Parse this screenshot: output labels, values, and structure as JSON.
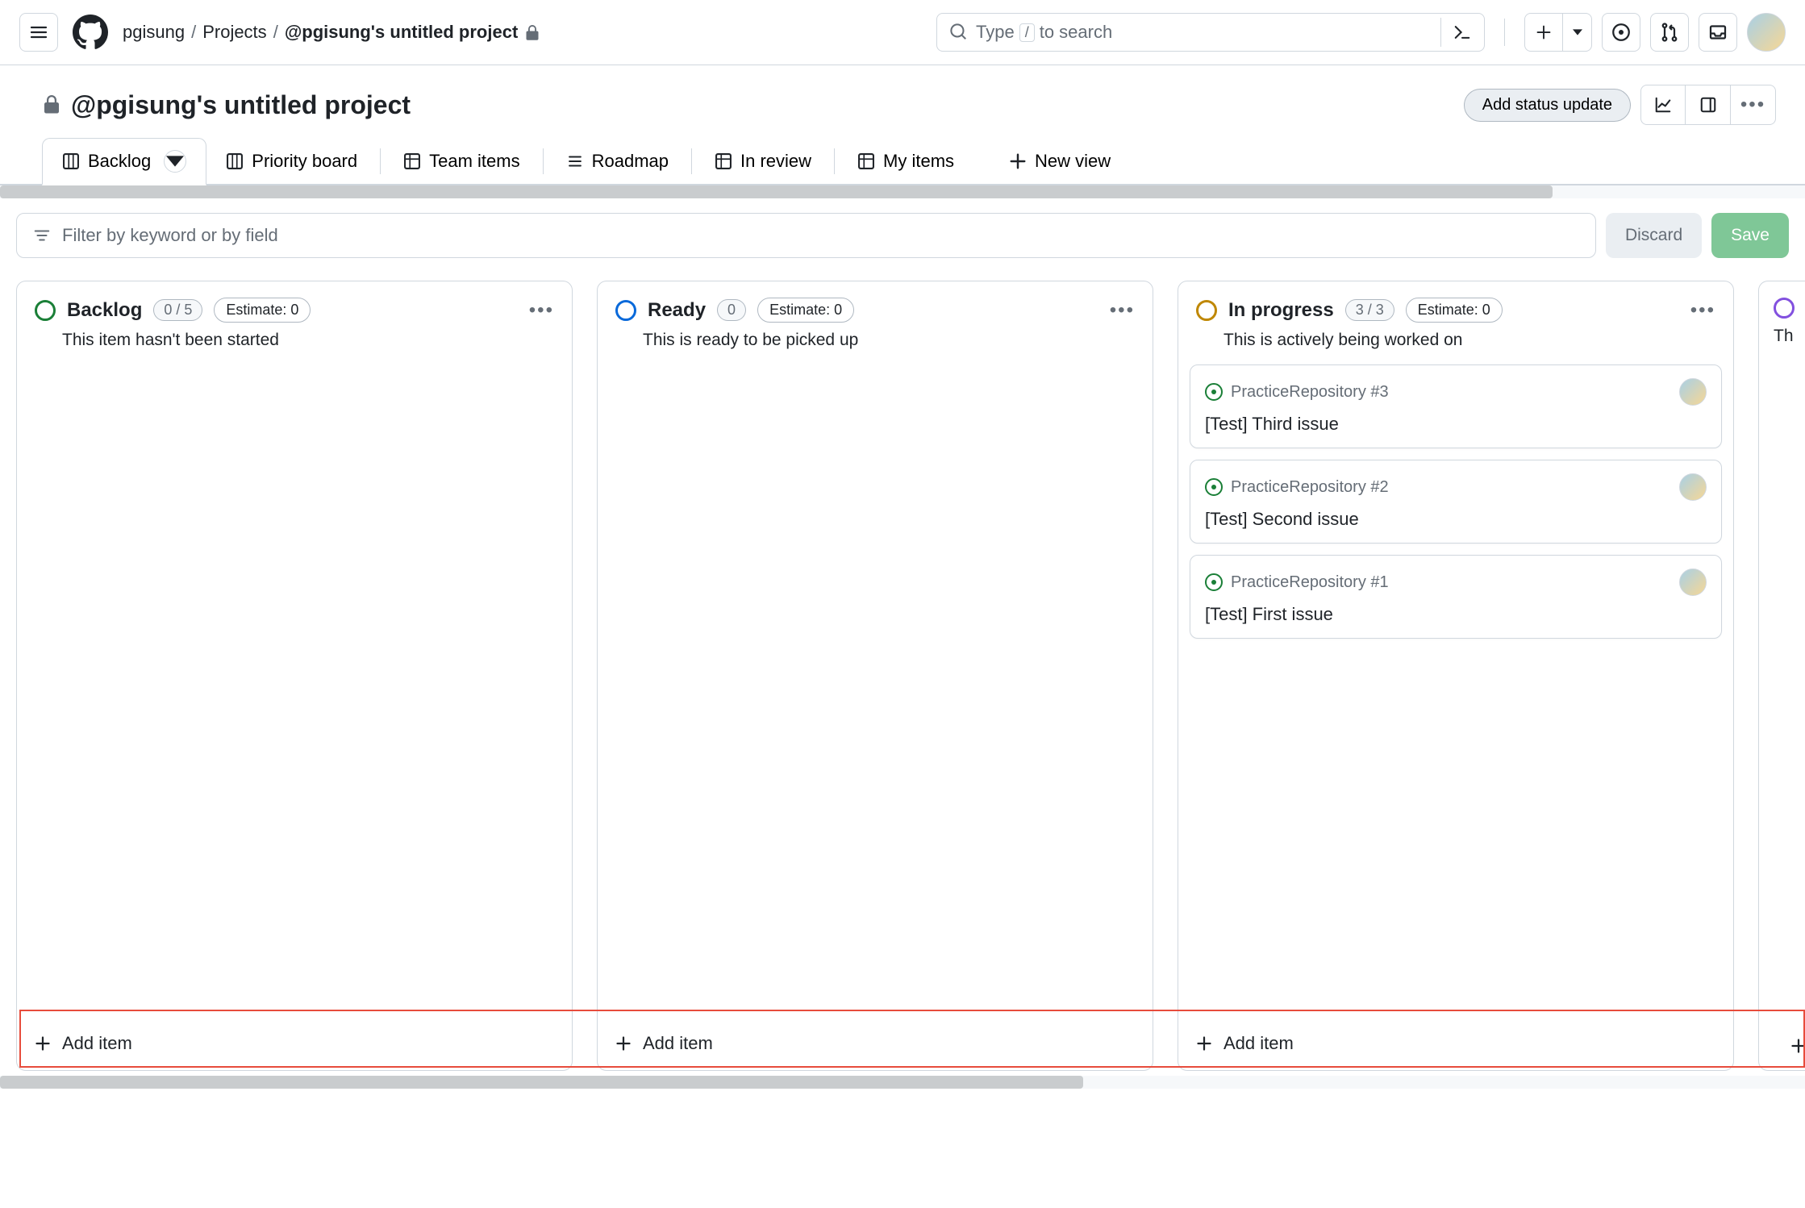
{
  "breadcrumb": {
    "owner": "pgisung",
    "section": "Projects",
    "current": "@pgisung's untitled project"
  },
  "search": {
    "prefix": "Type",
    "key": "/",
    "suffix": "to search"
  },
  "project": {
    "title": "@pgisung's untitled project",
    "status_update_label": "Add status update"
  },
  "tabs": [
    {
      "label": "Backlog",
      "icon": "board",
      "active": true,
      "dropdown": true
    },
    {
      "label": "Priority board",
      "icon": "board"
    },
    {
      "label": "Team items",
      "icon": "table"
    },
    {
      "label": "Roadmap",
      "icon": "list"
    },
    {
      "label": "In review",
      "icon": "table"
    },
    {
      "label": "My items",
      "icon": "table"
    }
  ],
  "new_view_label": "New view",
  "filter": {
    "placeholder": "Filter by keyword or by field",
    "discard_label": "Discard",
    "save_label": "Save"
  },
  "columns": [
    {
      "title": "Backlog",
      "color": "#1a7f37",
      "count": "0 / 5",
      "estimate": "Estimate: 0",
      "description": "This item hasn't been started",
      "cards": [],
      "add_label": "Add item"
    },
    {
      "title": "Ready",
      "color": "#0969da",
      "count": "0",
      "estimate": "Estimate: 0",
      "description": "This is ready to be picked up",
      "cards": [],
      "add_label": "Add item"
    },
    {
      "title": "In progress",
      "color": "#bf8700",
      "count": "3 / 3",
      "estimate": "Estimate: 0",
      "description": "This is actively being worked on",
      "cards": [
        {
          "repo": "PracticeRepository #3",
          "title": "[Test] Third issue"
        },
        {
          "repo": "PracticeRepository #2",
          "title": "[Test] Second issue"
        },
        {
          "repo": "PracticeRepository #1",
          "title": "[Test] First issue"
        }
      ],
      "add_label": "Add item"
    },
    {
      "title": "",
      "color": "#8250df",
      "description_fragment": "Th",
      "partial": true
    }
  ]
}
